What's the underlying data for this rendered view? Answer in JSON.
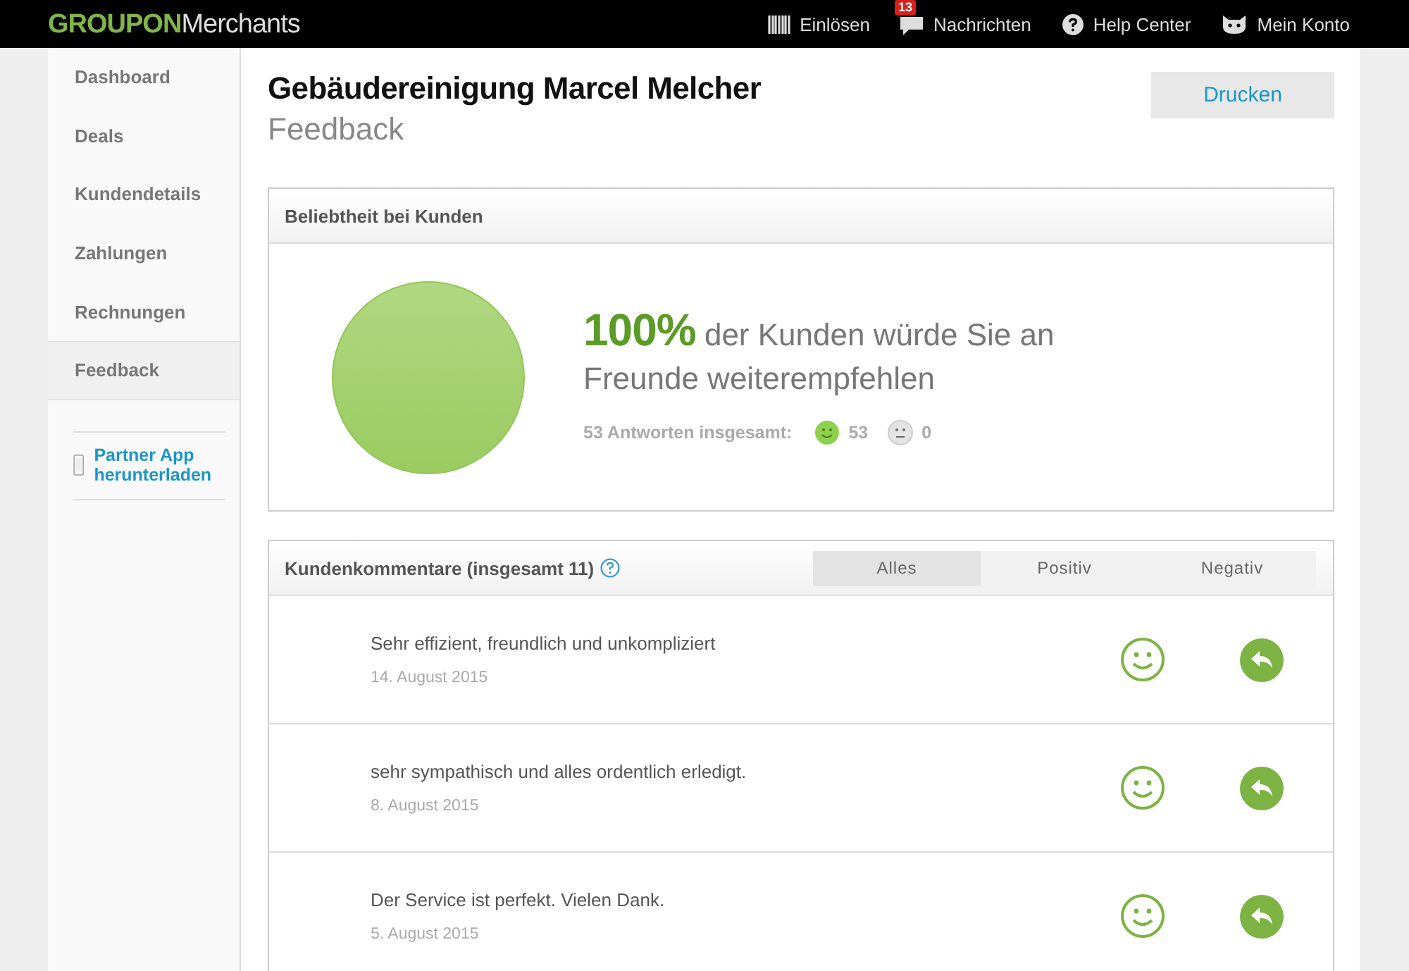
{
  "topbar": {
    "logo_brand": "GROUPON",
    "logo_product": "Merchants",
    "nav": [
      {
        "kind": "barcode",
        "label": "Einlösen"
      },
      {
        "kind": "messages",
        "label": "Nachrichten",
        "badge": "13"
      },
      {
        "kind": "help",
        "label": "Help Center"
      },
      {
        "kind": "account",
        "label": "Mein Konto"
      }
    ]
  },
  "sidebar": {
    "items": [
      {
        "label": "Dashboard",
        "selected": false
      },
      {
        "label": "Deals",
        "selected": false
      },
      {
        "label": "Kundendetails",
        "selected": false
      },
      {
        "label": "Zahlungen",
        "selected": false
      },
      {
        "label": "Rechnungen",
        "selected": false
      },
      {
        "label": "Feedback",
        "selected": true
      }
    ],
    "app_link": "Partner App herunterladen"
  },
  "header": {
    "title": "Gebäudereinigung Marcel Melcher",
    "subtitle": "Feedback",
    "print_button": "Drucken"
  },
  "popularity": {
    "title": "Beliebtheit bei Kunden",
    "percent": "100%",
    "text": "der Kunden würde Sie an Freunde weiterempfehlen",
    "summary_label": "53 Antworten insgesamt:",
    "positive_count": "53",
    "neutral_count": "0"
  },
  "comments": {
    "title": "Kundenkommentare (insgesamt 11)",
    "tabs": [
      {
        "label": "Alles",
        "selected": true
      },
      {
        "label": "Positiv",
        "selected": false
      },
      {
        "label": "Negativ",
        "selected": false
      }
    ],
    "rows": [
      {
        "text": "Sehr effizient, freundlich und unkompliziert",
        "date": "14. August 2015",
        "kind": "positive"
      },
      {
        "text": "sehr sympathisch und alles ordentlich erledigt.",
        "date": "8. August 2015",
        "kind": "positive"
      },
      {
        "text": "Der Service ist perfekt. Vielen Dank.",
        "date": "5. August 2015",
        "kind": "positive"
      }
    ]
  }
}
